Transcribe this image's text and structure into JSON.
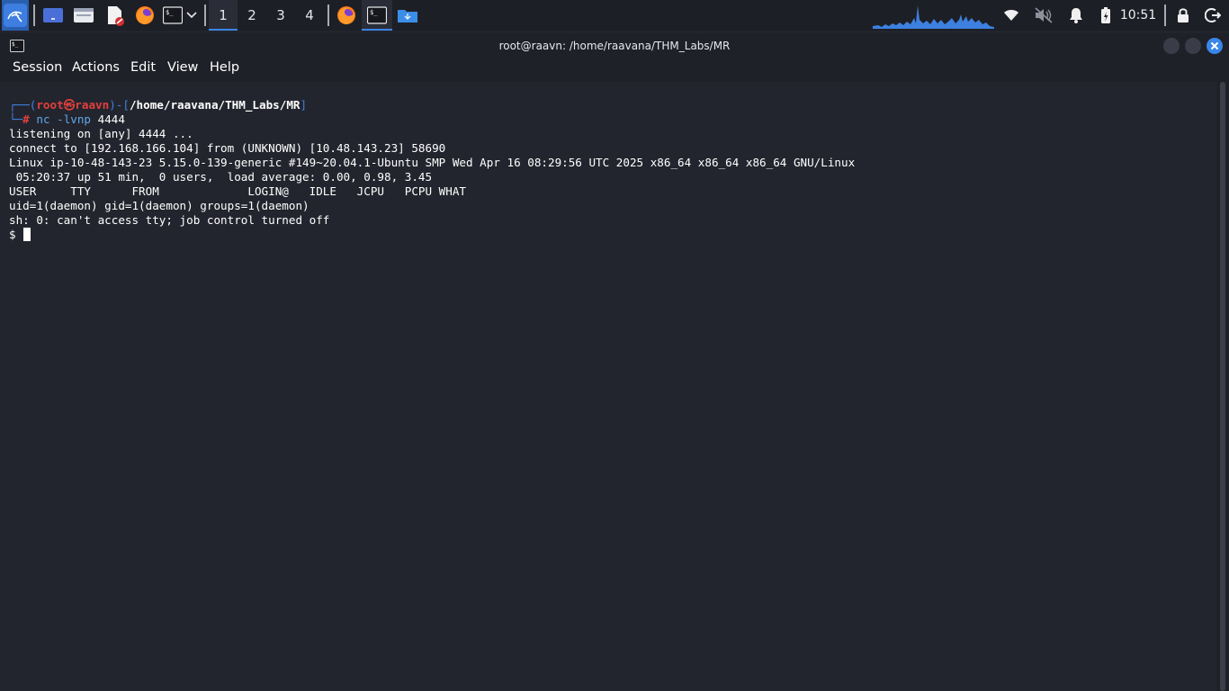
{
  "taskbar": {
    "workspaces": [
      "1",
      "2",
      "3",
      "4"
    ],
    "active_workspace": "1",
    "clock": "10:51",
    "icons": [
      "kali-menu-icon",
      "show-desktop-icon",
      "file-manager-icon",
      "text-editor-icon",
      "firefox-icon",
      "terminal-icon",
      "chevron-down-icon",
      "firefox-task-icon",
      "terminal-task-icon",
      "downloads-folder-icon",
      "network-icon",
      "muted-speaker-icon",
      "notification-bell-icon",
      "battery-charging-icon",
      "lock-icon",
      "logout-icon"
    ]
  },
  "window": {
    "title": "root@raavn: /home/raavana/THM_Labs/MR"
  },
  "menubar": {
    "session": "Session",
    "actions": "Actions",
    "edit": "Edit",
    "view": "View",
    "help": "Help"
  },
  "terminal": {
    "prompt": {
      "open": "┌──(",
      "user": "root",
      "at": "㉿",
      "host": "raavn",
      "mid": ")-[",
      "path": "/home/raavana/THM_Labs/MR",
      "close": "]",
      "corner": "└─",
      "hash": "#",
      "command": "nc -lvnp",
      "arg": "4444"
    },
    "output": [
      "listening on [any] 4444 ...",
      "connect to [192.168.166.104] from (UNKNOWN) [10.48.143.23] 58690",
      "Linux ip-10-48-143-23 5.15.0-139-generic #149~20.04.1-Ubuntu SMP Wed Apr 16 08:29:56 UTC 2025 x86_64 x86_64 x86_64 GNU/Linux",
      " 05:20:37 up 51 min,  0 users,  load average: 0.00, 0.98, 3.45",
      "USER     TTY      FROM             LOGIN@   IDLE   JCPU   PCPU WHAT",
      "uid=1(daemon) gid=1(daemon) groups=1(daemon)",
      "sh: 0: can't access tty; job control turned off"
    ],
    "shell_prompt": "$"
  },
  "colors": {
    "background": "#23252e",
    "accent": "#3a86e8",
    "prompt_user": "#e0403b",
    "prompt_frame": "#3d80e0",
    "close_button": "#3a86e8"
  }
}
